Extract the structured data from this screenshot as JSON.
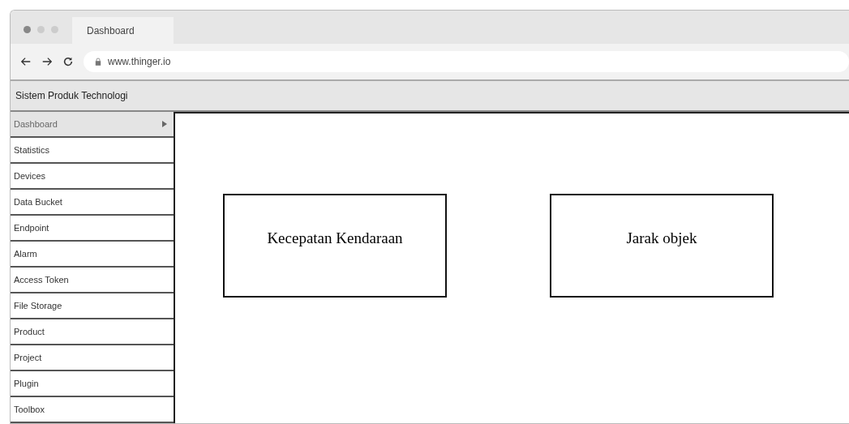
{
  "browser": {
    "tab": {
      "label": "Dashboard",
      "selected": true
    },
    "url": "www.thinger.io"
  },
  "app_title": "Sistem Produk Technologi",
  "sidebar": {
    "items": [
      {
        "label": "Dashboard",
        "selected": true
      },
      {
        "label": "Statistics",
        "selected": false
      },
      {
        "label": "Devices",
        "selected": false
      },
      {
        "label": "Data Bucket",
        "selected": false
      },
      {
        "label": "Endpoint",
        "selected": false
      },
      {
        "label": "Alarm",
        "selected": false
      },
      {
        "label": "Access Token",
        "selected": false
      },
      {
        "label": "File Storage",
        "selected": false
      },
      {
        "label": "Product",
        "selected": false
      },
      {
        "label": "Project",
        "selected": false
      },
      {
        "label": "Plugin",
        "selected": false
      },
      {
        "label": "Toolbox",
        "selected": false
      }
    ]
  },
  "widgets": [
    {
      "label": "Kecepatan Kendaraan"
    },
    {
      "label": "Jarak objek"
    }
  ]
}
